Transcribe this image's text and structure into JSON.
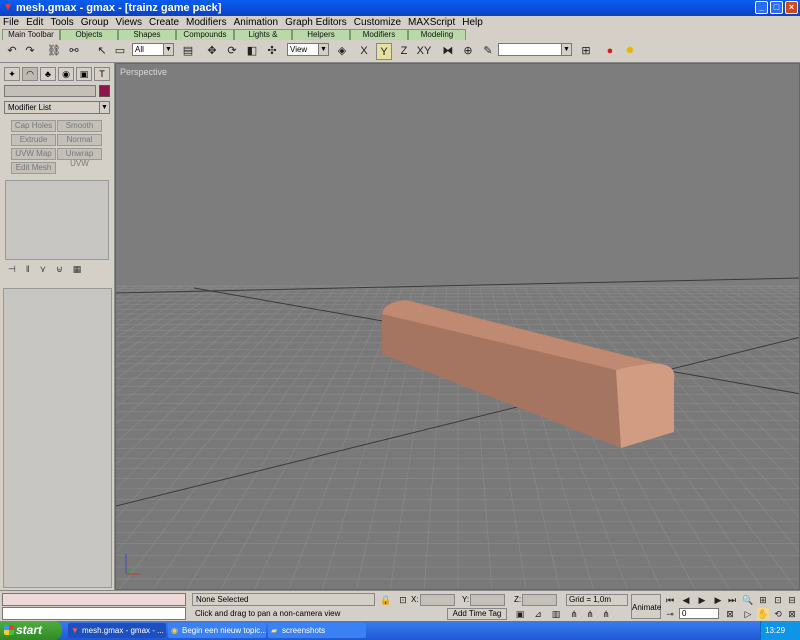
{
  "window": {
    "title": "mesh.gmax - gmax - [trainz game pack]"
  },
  "menu": [
    "File",
    "Edit",
    "Tools",
    "Group",
    "Views",
    "Create",
    "Modifiers",
    "Animation",
    "Graph Editors",
    "Customize",
    "MAXScript",
    "Help"
  ],
  "tabs": [
    "Main Toolbar",
    "Objects",
    "Shapes",
    "Compounds",
    "Lights & Cameras",
    "Helpers",
    "Modifiers",
    "Modeling"
  ],
  "toolbar": {
    "selection_filter": "All",
    "ref_coord": "View"
  },
  "command_panel": {
    "modifier_list": "Modifier List",
    "buttons": [
      "Cap Holes",
      "Smooth",
      "Extrude",
      "Normal",
      "UVW Map",
      "Unwrap UVW",
      "Edit Mesh"
    ]
  },
  "viewport": {
    "label": "Perspective"
  },
  "status": {
    "selection": "None Selected",
    "prompt": "Click and drag to pan a non-camera view",
    "x_label": "X:",
    "y_label": "Y:",
    "z_label": "Z:",
    "grid": "Grid = 1,0m",
    "add_time_tag": "Add Time Tag",
    "animate": "Animate",
    "frame": "0"
  },
  "taskbar": {
    "start": "start",
    "tasks": [
      "mesh.gmax - gmax - ...",
      "Begin een nieuw topic...",
      "screenshots"
    ],
    "clock": "13:29"
  },
  "colors": {
    "object_color": "#8e1549",
    "mesh_color": "#b07a65",
    "viewport_bg": "#7e7d7d"
  }
}
